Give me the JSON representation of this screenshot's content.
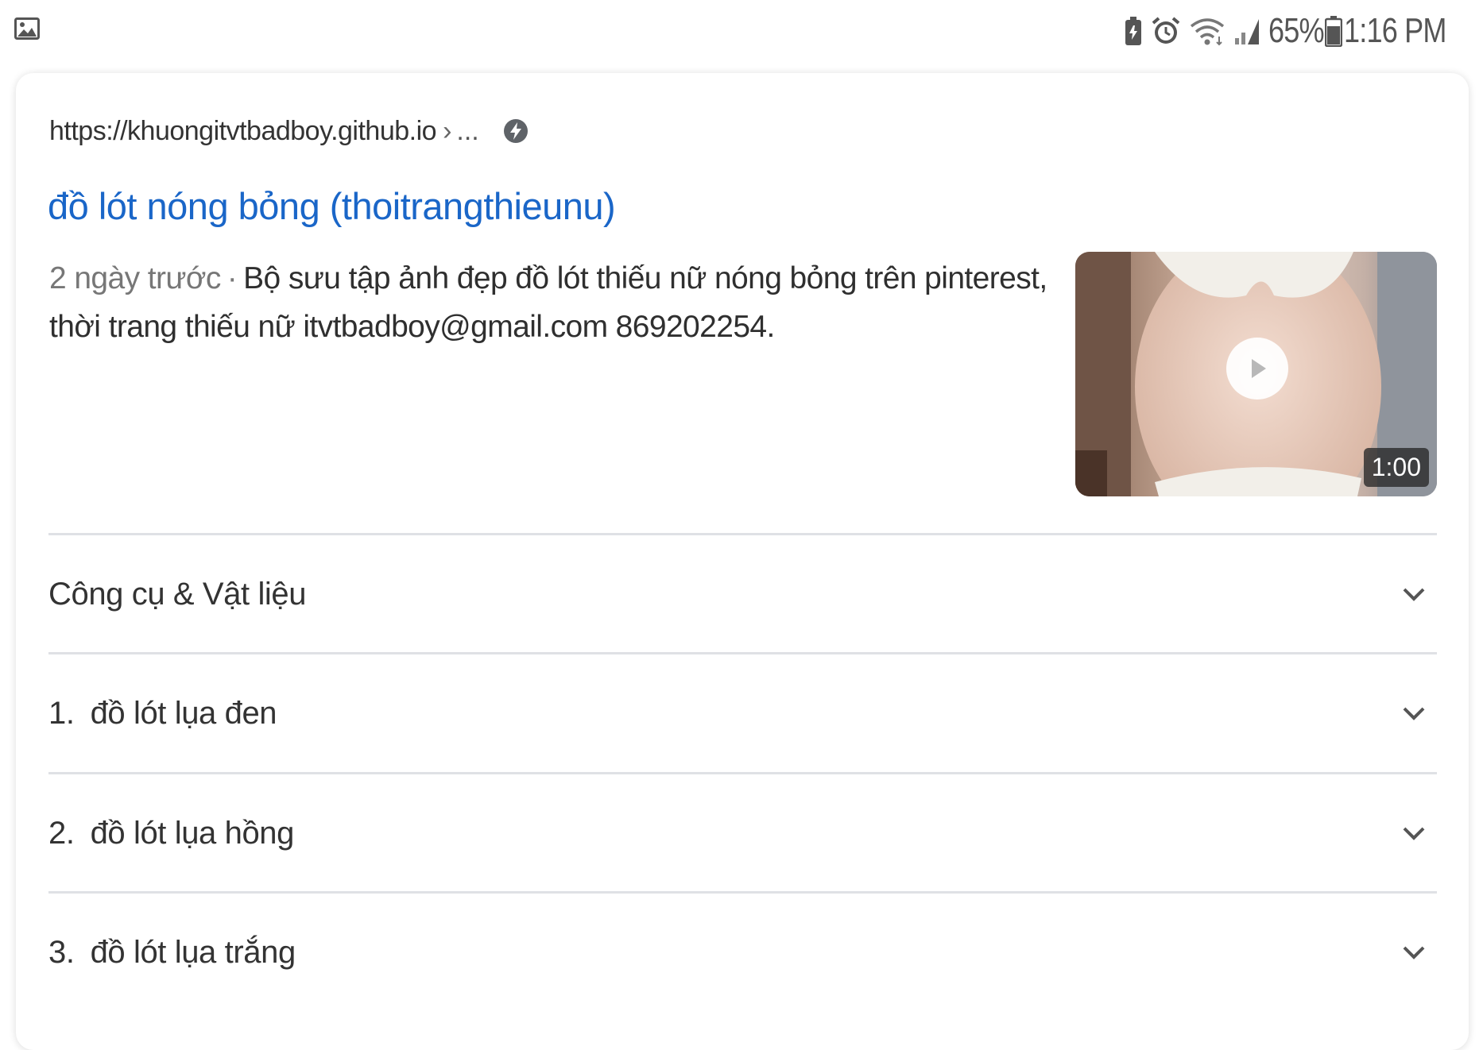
{
  "status_bar": {
    "battery_percent": "65%",
    "time": "1:16 PM",
    "icons": [
      "gallery-icon",
      "battery-saver-icon",
      "alarm-icon",
      "wifi-icon",
      "signal-icon",
      "battery-icon"
    ]
  },
  "result": {
    "url": "https://khuongitvtbadboy.github.io",
    "url_separator": "›",
    "url_more": "...",
    "amp_icon": "amp-lightning-icon",
    "title": "đồ lót nóng bỏng (thoitrangthieunu)",
    "date": "2 ngày trước",
    "date_separator": "·",
    "snippet": "Bộ sưu tập ảnh đẹp đồ lót thiếu nữ nóng bỏng trên pinterest, thời trang thiếu nữ itvtbadboy@gmail.com 869202254.",
    "video": {
      "duration": "1:00",
      "icon": "play-icon"
    }
  },
  "expandable_rows": [
    {
      "number": "",
      "label": "Công cụ & Vật liệu"
    },
    {
      "number": "1.",
      "label": "đồ lót lụa đen"
    },
    {
      "number": "2.",
      "label": "đồ lót lụa hồng"
    },
    {
      "number": "3.",
      "label": "đồ lót lụa trắng"
    }
  ],
  "colors": {
    "title_link": "#1a66c8",
    "divider": "#dfe1e5"
  }
}
